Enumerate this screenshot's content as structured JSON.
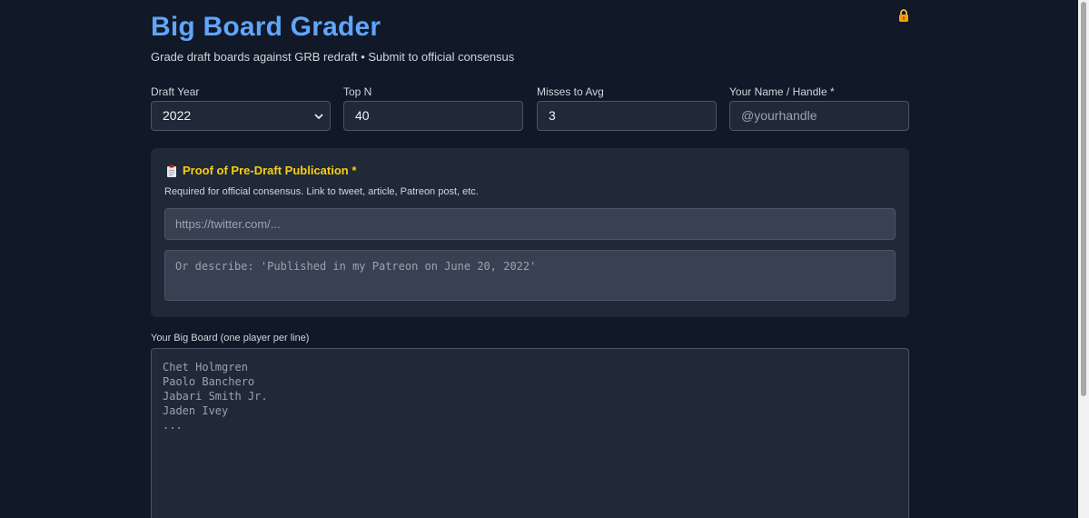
{
  "header": {
    "title": "Big Board Grader",
    "subtitle": "Grade draft boards against GRB redraft • Submit to official consensus"
  },
  "fields": {
    "draft_year": {
      "label": "Draft Year",
      "value": "2022"
    },
    "top_n": {
      "label": "Top N",
      "value": "40"
    },
    "misses_to_avg": {
      "label": "Misses to Avg",
      "value": "3"
    },
    "name_handle": {
      "label": "Your Name / Handle *",
      "placeholder": "@yourhandle"
    }
  },
  "proof": {
    "title": "Proof of Pre-Draft Publication *",
    "description": "Required for official consensus. Link to tweet, article, Patreon post, etc.",
    "url_placeholder": "https://twitter.com/...",
    "text_placeholder": "Or describe: 'Published in my Patreon on June 20, 2022'"
  },
  "board": {
    "label": "Your Big Board (one player per line)",
    "placeholder_lines": [
      "Chet Holmgren",
      "Paolo Banchero",
      "Jabari Smith Jr.",
      "Jaden Ivey",
      "..."
    ]
  },
  "colors": {
    "background": "#111827",
    "panel": "#1f2937",
    "accent": "#60a5fa",
    "highlight": "#facc15"
  },
  "icons": {
    "lock": "lock-icon",
    "clipboard": "clipboard-icon",
    "chevron": "chevron-down-icon"
  }
}
